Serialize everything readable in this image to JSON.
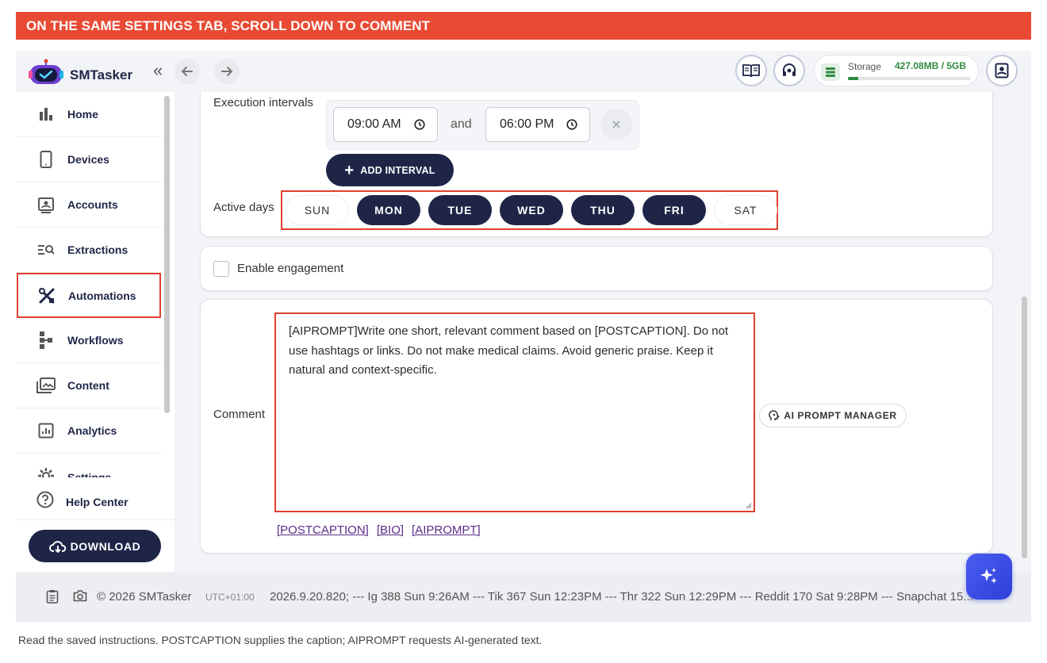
{
  "banner": "ON THE SAME SETTINGS TAB, SCROLL DOWN TO COMMENT",
  "header": {
    "brand": "SMTasker",
    "collapse": "«",
    "storage_label": "Storage",
    "storage_value": "427.08MB / 5GB",
    "storage_fraction": 0.085
  },
  "sidebar": {
    "items": [
      {
        "label": "Home",
        "icon": "bar-chart-icon"
      },
      {
        "label": "Devices",
        "icon": "phone-icon"
      },
      {
        "label": "Accounts",
        "icon": "contact-card-icon"
      },
      {
        "label": "Extractions",
        "icon": "list-search-icon"
      },
      {
        "label": "Automations",
        "icon": "tools-icon"
      },
      {
        "label": "Workflows",
        "icon": "flow-icon"
      },
      {
        "label": "Content",
        "icon": "images-icon"
      },
      {
        "label": "Analytics",
        "icon": "analytics-icon"
      },
      {
        "label": "Settings",
        "icon": "gear-icon"
      }
    ],
    "help": "Help Center",
    "download": "DOWNLOAD"
  },
  "schedule": {
    "intervals_label": "Execution intervals",
    "start": "09:00 AM",
    "and": "and",
    "end": "06:00 PM",
    "add_interval": "ADD INTERVAL",
    "active_days_label": "Active days",
    "days": [
      {
        "label": "SUN",
        "active": false
      },
      {
        "label": "MON",
        "active": true
      },
      {
        "label": "TUE",
        "active": true
      },
      {
        "label": "WED",
        "active": true
      },
      {
        "label": "THU",
        "active": true
      },
      {
        "label": "FRI",
        "active": true
      },
      {
        "label": "SAT",
        "active": false
      }
    ]
  },
  "engagement": {
    "label": "Enable engagement",
    "checked": false
  },
  "comment": {
    "label": "Comment",
    "value": "[AIPROMPT]Write one short, relevant comment based on [POSTCAPTION]. Do not use hashtags or links. Do not make medical claims. Avoid generic praise. Keep it natural and context-specific.",
    "ai_button": "AI PROMPT MANAGER",
    "vars": [
      "[POSTCAPTION]",
      "[BIO]",
      "[AIPROMPT]"
    ]
  },
  "footer": {
    "copyright": "© 2026 SMTasker",
    "tz": "UTC+01:00",
    "ticker": "2026.9.20.820; --- Ig 388 Sun 9:26AM --- Tik 367 Sun 12:23PM --- Thr 322 Sun 12:29PM --- Reddit 170 Sat 9:28PM --- Snapchat 15..."
  },
  "caption": "Read the saved instructions. POSTCAPTION supplies the caption; AIPROMPT requests AI-generated text."
}
